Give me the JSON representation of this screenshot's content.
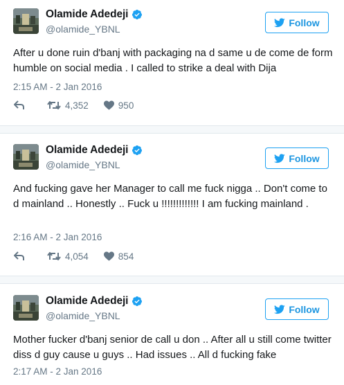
{
  "tweets": [
    {
      "name": "Olamide Adedeji",
      "handle": "@olamide_YBNL",
      "follow_label": "Follow",
      "text": "After u done ruin d'banj with packaging na d same u de come de form humble on social media . I called to strike a deal with Dija",
      "timestamp": "2:15 AM - 2 Jan 2016",
      "retweets": "4,352",
      "likes": "950"
    },
    {
      "name": "Olamide Adedeji",
      "handle": "@olamide_YBNL",
      "follow_label": "Follow",
      "text": "And fucking gave her Manager to call me fuck nigga .. Don't come to d mainland .. Honestly .. Fuck u !!!!!!!!!!!!! I am fucking mainland .",
      "timestamp": "2:16 AM - 2 Jan 2016",
      "retweets": "4,054",
      "likes": "854"
    },
    {
      "name": "Olamide Adedeji",
      "handle": "@olamide_YBNL",
      "follow_label": "Follow",
      "text": "Mother fucker d'banj senior de call u don .. After all u still come twitter diss d guy cause u guys .. Had issues .. All d fucking fake",
      "timestamp": "2:17 AM - 2 Jan 2016"
    }
  ],
  "colors": {
    "accent": "#1da1f2",
    "text": "#14171a",
    "muted": "#657786",
    "separator": "#f5f8fa"
  },
  "icons": [
    "avatar",
    "verified-badge-icon",
    "twitter-bird-icon",
    "reply-icon",
    "retweet-icon",
    "heart-icon"
  ]
}
